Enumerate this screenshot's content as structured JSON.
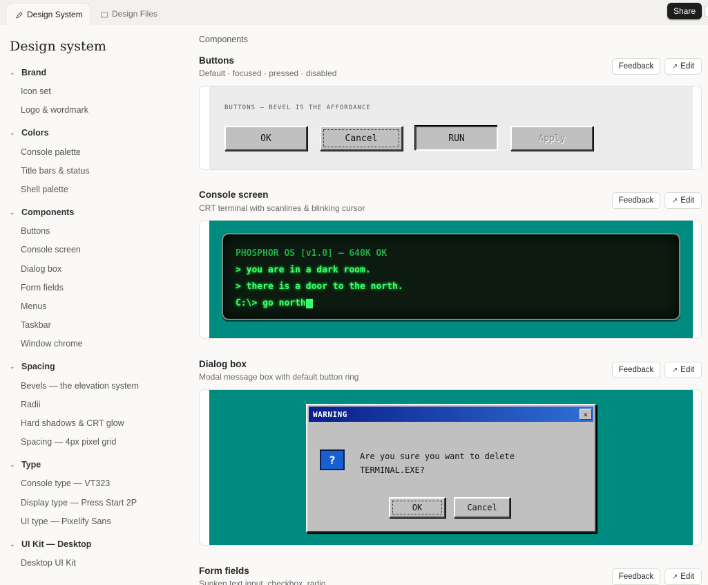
{
  "tabs": {
    "active": "Design System",
    "inactive": "Design Files"
  },
  "share_label": "Share",
  "sidebar": {
    "title": "Design system",
    "groups": [
      {
        "label": "Brand",
        "items": [
          "Icon set",
          "Logo & wordmark"
        ]
      },
      {
        "label": "Colors",
        "items": [
          "Console palette",
          "Title bars & status",
          "Shell palette"
        ]
      },
      {
        "label": "Components",
        "items": [
          "Buttons",
          "Console screen",
          "Dialog box",
          "Form fields",
          "Menus",
          "Taskbar",
          "Window chrome"
        ]
      },
      {
        "label": "Spacing",
        "items": [
          "Bevels — the elevation system",
          "Radii",
          "Hard shadows & CRT glow",
          "Spacing — 4px pixel grid"
        ]
      },
      {
        "label": "Type",
        "items": [
          "Console type — VT323",
          "Display type — Press Start 2P",
          "UI type — Pixelify Sans"
        ]
      },
      {
        "label": "UI Kit — Desktop",
        "items": [
          "Desktop UI Kit"
        ]
      }
    ]
  },
  "main": {
    "breadcrumb": "Components",
    "feedback_label": "Feedback",
    "edit_label": "Edit",
    "buttons_section": {
      "title": "Buttons",
      "subtitle": "Default · focused · pressed · disabled",
      "demo_label": "BUTTONS — BEVEL IS THE AFFORDANCE",
      "buttons": [
        "OK",
        "Cancel",
        "RUN",
        "Apply"
      ]
    },
    "console_section": {
      "title": "Console screen",
      "subtitle": "CRT terminal with scanlines & blinking cursor",
      "lines": [
        "PHOSPHOR OS [v1.0] — 640K OK",
        "> you are in a dark room.",
        "> there is a door to the north.",
        "C:\\> go north"
      ]
    },
    "dialog_section": {
      "title": "Dialog box",
      "subtitle": "Modal message box with default button ring",
      "dialog_title": "WARNING",
      "close_glyph": "✕",
      "icon_glyph": "?",
      "message_line1": "Are you sure you want to delete",
      "message_line2": "TERMINAL.EXE?",
      "ok_label": "OK",
      "cancel_label": "Cancel"
    },
    "form_section": {
      "title": "Form fields",
      "subtitle": "Sunken text input, checkbox, radio"
    }
  },
  "colors": {
    "teal": "#008b80",
    "crt_green": "#3cff6a",
    "bevel_gray": "#c0c0c0",
    "title_blue": "#0a1e88"
  }
}
